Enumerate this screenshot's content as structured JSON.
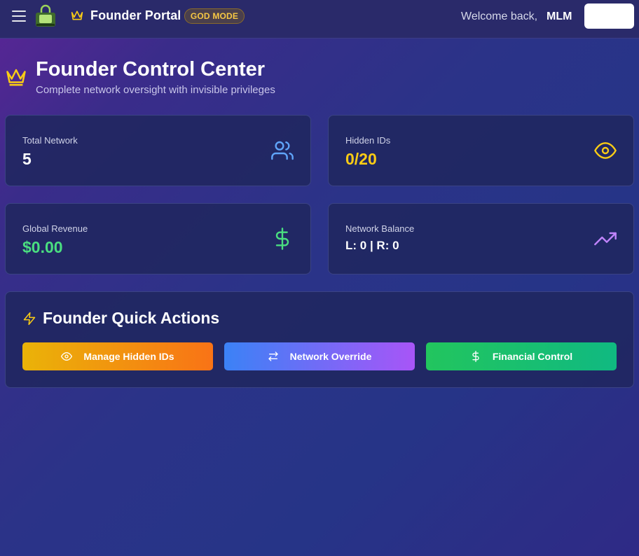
{
  "header": {
    "brand_title": "Founder Portal",
    "badge": "GOD MODE",
    "welcome_text": "Welcome back,",
    "username": "MLM"
  },
  "page": {
    "title": "Founder Control Center",
    "subtitle": "Complete network oversight with invisible privileges"
  },
  "stats": [
    {
      "label": "Total Network",
      "value": "5",
      "icon": "users-icon",
      "color": "#ffffff",
      "icon_color": "#60a5fa"
    },
    {
      "label": "Hidden IDs",
      "value": "0/20",
      "icon": "eye-icon",
      "color": "#facc15",
      "icon_color": "#facc15"
    },
    {
      "label": "Global Revenue",
      "value": "$0.00",
      "icon": "dollar-icon",
      "color": "#4ade80",
      "icon_color": "#4ade80"
    },
    {
      "label": "Network Balance",
      "value": "L: 0 | R: 0",
      "icon": "trending-up-icon",
      "color": "#ffffff",
      "icon_color": "#c084fc"
    }
  ],
  "quick_actions": {
    "title": "Founder Quick Actions",
    "buttons": [
      {
        "label": "Manage Hidden IDs",
        "icon": "eye-icon"
      },
      {
        "label": "Network Override",
        "icon": "swap-arrows-icon"
      },
      {
        "label": "Financial Control",
        "icon": "dollar-icon"
      }
    ]
  }
}
